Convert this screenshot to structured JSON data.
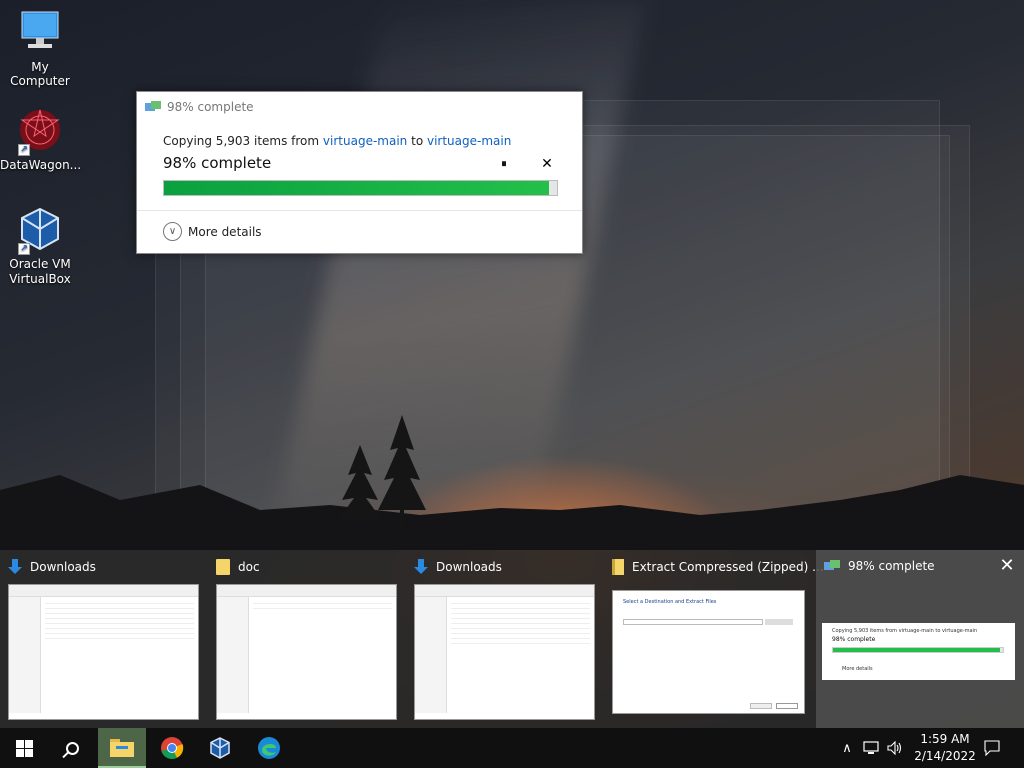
{
  "desktop": {
    "icons": [
      {
        "label": "My Computer",
        "icon": "computer-icon"
      },
      {
        "label": "DataWagon...",
        "icon": "datawagon-icon"
      },
      {
        "label": "Oracle VM VirtualBox",
        "icon": "virtualbox-icon"
      }
    ]
  },
  "dialog": {
    "title": "98% complete",
    "copy_prefix": "Copying 5,903 items from",
    "source": "virtuage-main",
    "to_word": "to",
    "destination": "virtuage-main",
    "percent_text": "98% complete",
    "progress": 0.98,
    "more_details": "More details",
    "pause_glyph": "⏸",
    "close_glyph": "✕"
  },
  "task_switcher": {
    "items": [
      {
        "title": "Downloads",
        "icon": "download-arrow-icon"
      },
      {
        "title": "doc",
        "icon": "folder-icon"
      },
      {
        "title": "Downloads",
        "icon": "download-arrow-icon"
      },
      {
        "title": "Extract Compressed (Zipped) ...",
        "icon": "zip-folder-icon"
      },
      {
        "title": "98% complete",
        "icon": "copy-progress-icon"
      }
    ],
    "close_glyph": "✕",
    "preview_extract_heading": "Select a Destination and Extract Files",
    "preview_copy_line": "Copying 5,903 items from virtuage-main to virtuage-main",
    "preview_copy_pct": "98% complete",
    "preview_more": "More details"
  },
  "taskbar": {
    "apps": [
      "start-icon",
      "search-icon",
      "file-explorer-icon",
      "chrome-icon",
      "virtualbox-icon",
      "edge-icon"
    ],
    "time": "1:59 AM",
    "date": "2/14/2022",
    "tray_icons": [
      "chevron-up-icon",
      "network-icon",
      "volume-icon",
      "notification-icon"
    ]
  },
  "colors": {
    "progress": "#22c04a",
    "link": "#1060c0",
    "taskbar": "#101010"
  }
}
